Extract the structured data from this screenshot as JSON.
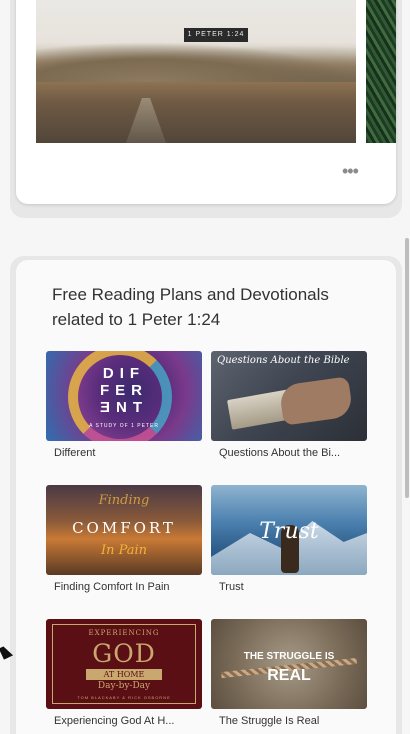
{
  "verse_card": {
    "verse_reference": "1 PETER 1:24",
    "more_label": "•••"
  },
  "plans_section": {
    "title": "Free Reading Plans and Devotionals related to 1 Peter 1:24",
    "plans": [
      {
        "label": "Different",
        "thumb_text": "DIF\nFER\nƎNT",
        "thumb_sub": "A STUDY OF 1 PETER"
      },
      {
        "label": "Questions About the Bi...",
        "thumb_text": "Questions About the Bible"
      },
      {
        "label": "Finding Comfort In Pain",
        "thumb_lines": [
          "Finding",
          "COMFORT",
          "In Pain"
        ]
      },
      {
        "label": "Trust",
        "thumb_text": "Trust"
      },
      {
        "label": "Experiencing God At H...",
        "thumb_lines": [
          "EXPERIENCING",
          "GOD",
          "AT HOME",
          "Day-by-Day",
          "TOM BLACKABY & RICK OSBORNE"
        ]
      },
      {
        "label": "The Struggle Is Real",
        "thumb_lines": [
          "THE STRUGGLE IS",
          "REAL"
        ]
      }
    ]
  }
}
